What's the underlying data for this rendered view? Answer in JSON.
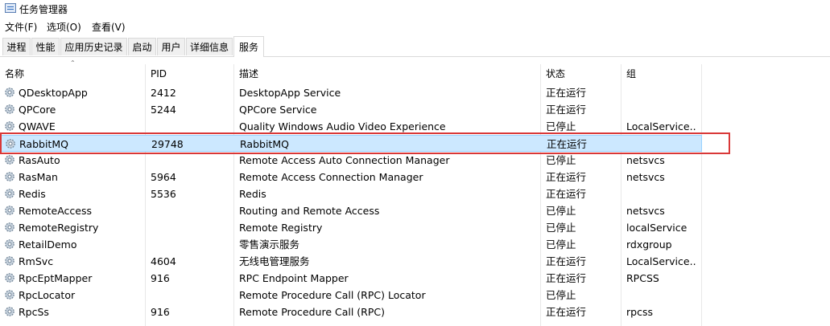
{
  "window": {
    "title": "任务管理器"
  },
  "menu": [
    "文件(F)",
    "选项(O)",
    "查看(V)"
  ],
  "tabs": [
    {
      "label": "进程"
    },
    {
      "label": "性能"
    },
    {
      "label": "应用历史记录"
    },
    {
      "label": "启动"
    },
    {
      "label": "用户"
    },
    {
      "label": "详细信息"
    },
    {
      "label": "服务",
      "active": true
    }
  ],
  "columns": [
    "名称",
    "PID",
    "描述",
    "状态",
    "组"
  ],
  "services": [
    {
      "name": "QDesktopApp",
      "pid": "2412",
      "desc": "DesktopApp Service",
      "status": "正在运行",
      "group": ""
    },
    {
      "name": "QPCore",
      "pid": "5244",
      "desc": "QPCore Service",
      "status": "正在运行",
      "group": ""
    },
    {
      "name": "QWAVE",
      "pid": "",
      "desc": "Quality Windows Audio Video Experience",
      "status": "已停止",
      "group": "LocalService..."
    },
    {
      "name": "RabbitMQ",
      "pid": "29748",
      "desc": "RabbitMQ",
      "status": "正在运行",
      "group": "",
      "selected": true
    },
    {
      "name": "RasAuto",
      "pid": "",
      "desc": "Remote Access Auto Connection Manager",
      "status": "已停止",
      "group": "netsvcs"
    },
    {
      "name": "RasMan",
      "pid": "5964",
      "desc": "Remote Access Connection Manager",
      "status": "正在运行",
      "group": "netsvcs"
    },
    {
      "name": "Redis",
      "pid": "5536",
      "desc": "Redis",
      "status": "正在运行",
      "group": ""
    },
    {
      "name": "RemoteAccess",
      "pid": "",
      "desc": "Routing and Remote Access",
      "status": "已停止",
      "group": "netsvcs"
    },
    {
      "name": "RemoteRegistry",
      "pid": "",
      "desc": "Remote Registry",
      "status": "已停止",
      "group": "localService"
    },
    {
      "name": "RetailDemo",
      "pid": "",
      "desc": "零售演示服务",
      "status": "已停止",
      "group": "rdxgroup"
    },
    {
      "name": "RmSvc",
      "pid": "4604",
      "desc": "无线电管理服务",
      "status": "正在运行",
      "group": "LocalService..."
    },
    {
      "name": "RpcEptMapper",
      "pid": "916",
      "desc": "RPC Endpoint Mapper",
      "status": "正在运行",
      "group": "RPCSS"
    },
    {
      "name": "RpcLocator",
      "pid": "",
      "desc": "Remote Procedure Call (RPC) Locator",
      "status": "已停止",
      "group": ""
    },
    {
      "name": "RpcSs",
      "pid": "916",
      "desc": "Remote Procedure Call (RPC)",
      "status": "正在运行",
      "group": "rpcss"
    }
  ],
  "colors": {
    "selection": "#cce8ff",
    "highlight": "#d93838"
  }
}
